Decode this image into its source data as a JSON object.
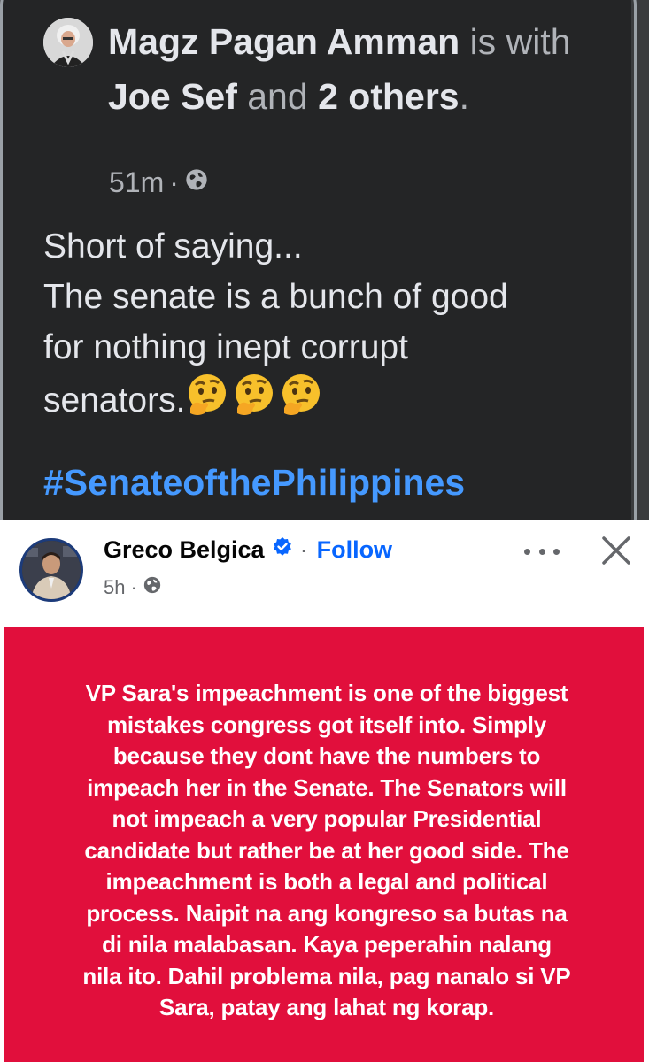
{
  "post_top": {
    "author": "Magz Pagan Amman",
    "with_word_is": "is",
    "with_word_with": "with",
    "tagged": "Joe Sef",
    "and_word": "and",
    "others_count": "2",
    "others_word": "others",
    "period": ".",
    "time": "51m",
    "separator": "·",
    "privacy_icon": "globe-icon",
    "text_line1": "Short of saying...",
    "text_line2": "The senate is a bunch of good",
    "text_line3": "for nothing inept corrupt",
    "text_line4": "senators.",
    "emojis": [
      "🤔",
      "🤔",
      "🤔"
    ],
    "hashtag": "#SenateofthePhilippines",
    "colors": {
      "background": "#242526",
      "text": "#e4e6eb",
      "muted": "#b0b3b8",
      "link": "#4599ff"
    }
  },
  "post_shared": {
    "author": "Greco Belgica",
    "verified_icon": "verified-badge-icon",
    "separator": "·",
    "follow_label": "Follow",
    "more_icon": "more-options-icon",
    "close_icon": "close-icon",
    "time": "5h",
    "privacy_icon": "globe-icon",
    "banner_lines": [
      "VP Sara's impeachment is one of the biggest",
      "mistakes congress got itself into. Simply",
      "because they dont have the numbers to",
      "impeach her in the Senate. The Senators will",
      "not impeach a very popular Presidential",
      "candidate but rather be at her good side. The",
      "impeachment is both a legal and political",
      "process. Naipit na ang kongreso sa butas na",
      "di nila malabasan. Kaya peperahin nalang",
      "nila ito. Dahil problema nila, pag nanalo si VP",
      "Sara, patay ang lahat ng korap."
    ],
    "colors": {
      "banner": "#e10f3c",
      "follow": "#0866ff",
      "name": "#050505"
    }
  }
}
